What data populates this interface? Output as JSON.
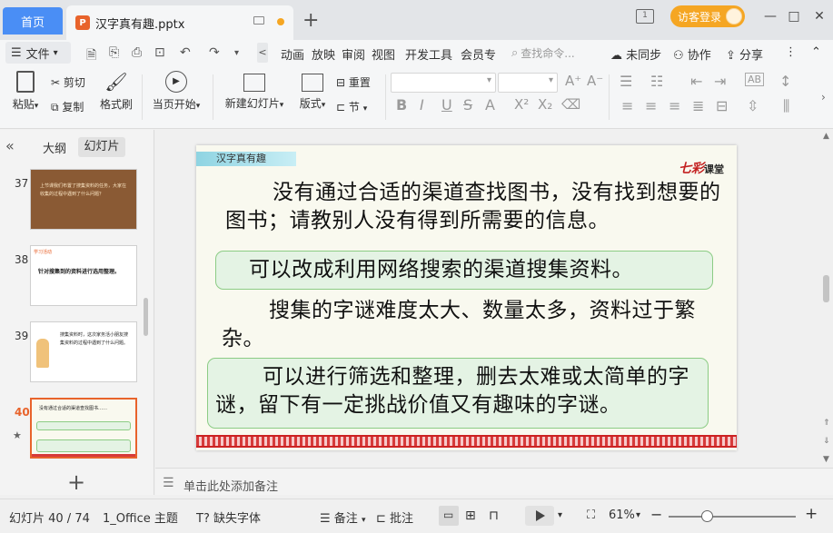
{
  "titlebar": {
    "home_tab": "首页",
    "doc_tab": "汉字真有趣.pptx",
    "doc_icon": "P",
    "new_tab": "+",
    "pages_badge": "1",
    "login_label": "访客登录",
    "window_controls": [
      "—",
      "□",
      "✕"
    ]
  },
  "menubar": {
    "file_label": "文件",
    "items": [
      "动画",
      "放映",
      "审阅",
      "视图",
      "开发工具",
      "会员专"
    ],
    "search_placeholder": "查找命令...",
    "right": [
      "未同步",
      "协作",
      "分享"
    ]
  },
  "ribbon": {
    "paste": "粘贴",
    "cut": "剪切",
    "copy": "复制",
    "format_painter": "格式刷",
    "from_current": "当页开始",
    "new_slide": "新建幻灯片",
    "layout": "版式",
    "reset": "重置",
    "section": "节"
  },
  "leftpane": {
    "tab_outline": "大纲",
    "tab_slides": "幻灯片",
    "slides": [
      {
        "num": "37",
        "text": "上节课我们布置了搜集资料的任务，大家在收集的过程中遇到了什么问题？"
      },
      {
        "num": "38",
        "label": "学习活动",
        "text": "针对搜集到的资料进行选用整理。"
      },
      {
        "num": "39",
        "text": "搜集资料时，这次家务活小朋友搜集资料的过程中遇到了什么问题。"
      },
      {
        "num": "40",
        "text": "没有通过合适的渠道查找图书……"
      }
    ],
    "add_slide": "+"
  },
  "slide": {
    "title_tag": "汉字真有趣",
    "brand_main": "七彩",
    "brand_sub": "课堂",
    "p1": "没有通过合适的渠道查找图书，没有找到想要的图书；请教别人没有得到所需要的信息。",
    "p2": "可以改成利用网络搜索的渠道搜集资料。",
    "p3": "搜集的字谜难度太大、数量太多，资料过于繁杂。",
    "p4": "可以进行筛选和整理，删去太难或太简单的字谜，留下有一定挑战价值又有趣味的字谜。"
  },
  "notes": {
    "placeholder": "单击此处添加备注"
  },
  "statusbar": {
    "slide_position": "幻灯片 40 / 74",
    "theme": "1_Office 主题",
    "missing_font": "缺失字体",
    "notes": "备注",
    "comments": "批注",
    "zoom": "61%"
  },
  "colors": {
    "accent": "#4a8ef5",
    "doc_icon": "#e8632b",
    "login": "#f5a623",
    "slide_bg": "#f9f9ef",
    "green_box": "#e4f3e4"
  }
}
